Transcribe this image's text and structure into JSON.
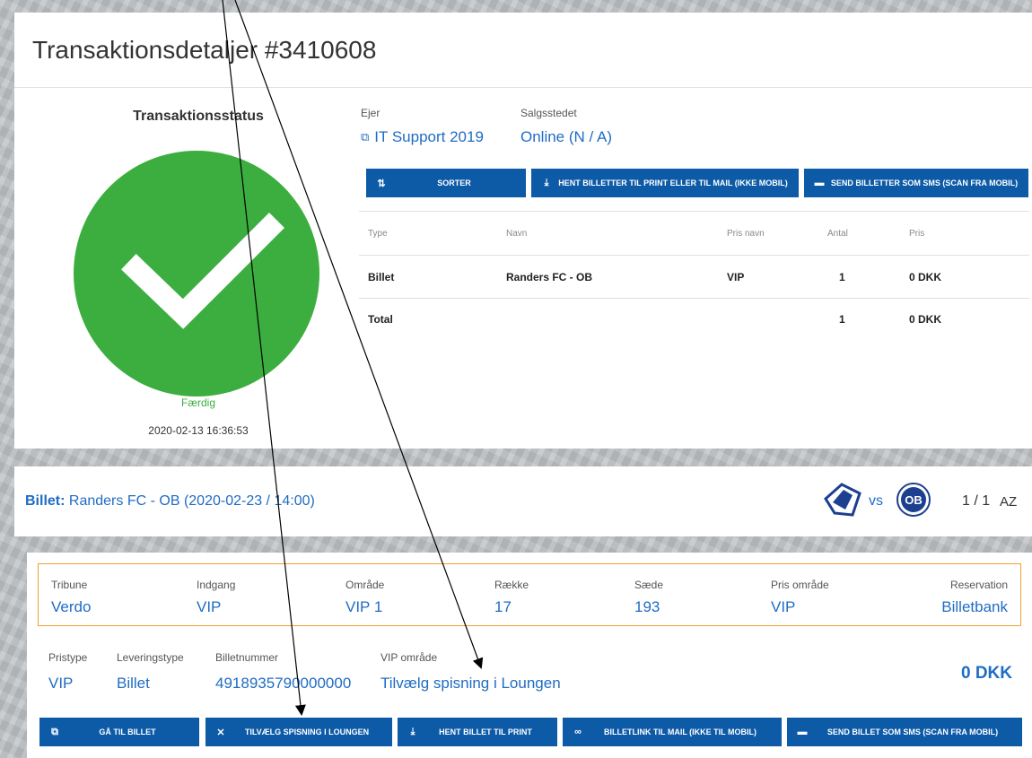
{
  "header": {
    "title": "Transaktionsdetaljer #3410608"
  },
  "status": {
    "title": "Transaktionsstatus",
    "state": "Færdig",
    "timestamp": "2020-02-13 16:36:53",
    "state_color": "#3cae3f"
  },
  "owner": {
    "label": "Ejer",
    "value": "IT Support 2019"
  },
  "salespoint": {
    "label": "Salgsstedet",
    "value": "Online (N / A)"
  },
  "actions": {
    "sort": "SORTER",
    "fetch_print": "HENT BILLETTER TIL PRINT ELLER TIL MAIL (IKKE MOBIL)",
    "send_sms": "SEND BILLETTER SOM SMS (SCAN FRA MOBIL)"
  },
  "table": {
    "headers": [
      "Type",
      "Navn",
      "Pris navn",
      "Antal",
      "Pris"
    ],
    "rows": [
      [
        "Billet",
        "Randers FC - OB",
        "VIP",
        "1",
        "0 DKK"
      ]
    ],
    "total": {
      "label": "Total",
      "count": "1",
      "price": "0 DKK"
    }
  },
  "ticket": {
    "label": "Billet:",
    "title": "Randers FC - OB (2020-02-23 / 14:00)",
    "vs": "vs",
    "away_logo_text": "OB",
    "pager": "1 / 1",
    "sort_icon_text": "AZ"
  },
  "seat": {
    "fields": [
      {
        "label": "Tribune",
        "value": "Verdo"
      },
      {
        "label": "Indgang",
        "value": "VIP"
      },
      {
        "label": "Område",
        "value": "VIP 1"
      },
      {
        "label": "Række",
        "value": "17"
      },
      {
        "label": "Sæde",
        "value": "193"
      },
      {
        "label": "Pris område",
        "value": "VIP"
      },
      {
        "label": "Reservation",
        "value": "Billetbank"
      }
    ]
  },
  "details": {
    "pristype": {
      "label": "Pristype",
      "value": "VIP"
    },
    "leveringstype": {
      "label": "Leveringstype",
      "value": "Billet"
    },
    "billetnummer": {
      "label": "Billetnummer",
      "value": "4918935790000000"
    },
    "vip": {
      "label": "VIP område",
      "value": "Tilvælg spisning i Loungen"
    },
    "price": "0 DKK"
  },
  "ticket_actions": {
    "goto": "GÅ TIL BILLET",
    "dining": "TILVÆLG SPISNING I LOUNGEN",
    "print": "HENT BILLET TIL PRINT",
    "link": "BILLETLINK TIL MAIL (IKKE TIL MOBIL)",
    "sms": "SEND BILLET SOM SMS (SCAN FRA MOBIL)"
  },
  "colors": {
    "button": "#0d5aa7",
    "link": "#1f6cc3",
    "success": "#3cae3f",
    "highlight_border": "#f0a030"
  },
  "icons": [
    "sort-az-icon",
    "download-icon",
    "sms-icon",
    "external-link-icon",
    "utensils-icon",
    "link-icon",
    "checkmark-icon"
  ]
}
